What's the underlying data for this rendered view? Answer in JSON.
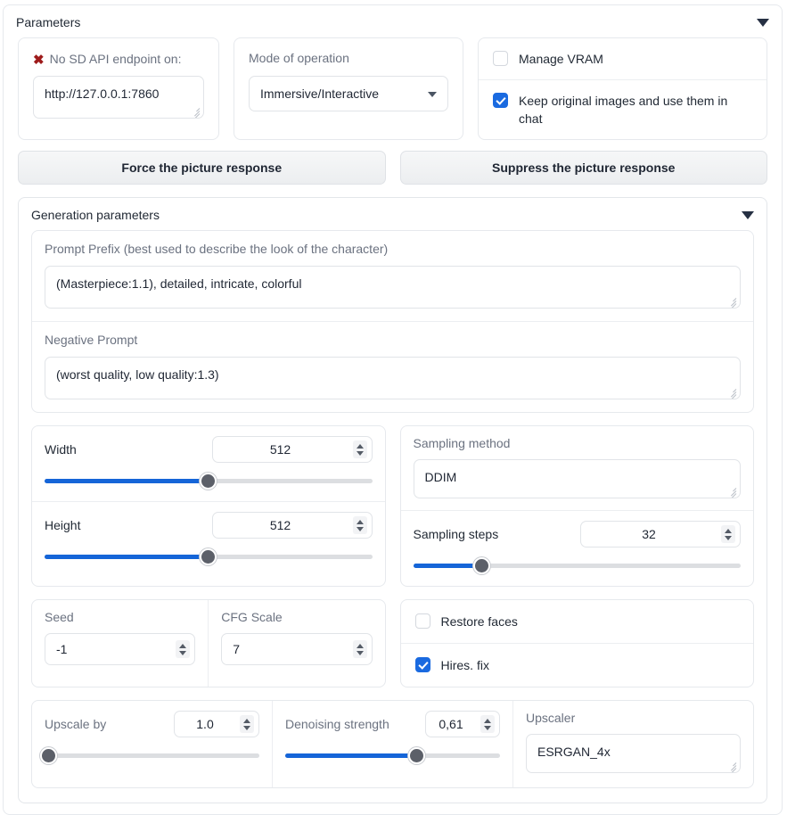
{
  "root": {
    "title": "Parameters",
    "collapse_icon": "caret-down-icon"
  },
  "api": {
    "status_icon": "red-x-icon",
    "status_label": "No SD API endpoint on:",
    "endpoint_value": "http://127.0.0.1:7860"
  },
  "mode": {
    "label": "Mode of operation",
    "selected": "Immersive/Interactive",
    "dropdown_icon": "chevron-down-icon"
  },
  "options": {
    "manage_vram": {
      "label": "Manage VRAM",
      "checked": false
    },
    "keep_original": {
      "label": "Keep original images and use them in chat",
      "checked": true
    }
  },
  "buttons": {
    "force": "Force the picture response",
    "suppress": "Suppress the picture response"
  },
  "generation": {
    "title": "Generation parameters",
    "collapse_icon": "caret-down-icon",
    "prompt_prefix": {
      "label": "Prompt Prefix (best used to describe the look of the character)",
      "value": "(Masterpiece:1.1), detailed, intricate, colorful"
    },
    "negative_prompt": {
      "label": "Negative Prompt",
      "value": "(worst quality, low quality:1.3)"
    },
    "width": {
      "label": "Width",
      "value": "512",
      "percent": 50
    },
    "height": {
      "label": "Height",
      "value": "512",
      "percent": 50
    },
    "sampling_method": {
      "label": "Sampling method",
      "value": "DDIM"
    },
    "sampling_steps": {
      "label": "Sampling steps",
      "value": "32",
      "percent": 21
    },
    "seed": {
      "label": "Seed",
      "value": "-1"
    },
    "cfg_scale": {
      "label": "CFG Scale",
      "value": "7"
    },
    "restore_faces": {
      "label": "Restore faces",
      "checked": false
    },
    "hires_fix": {
      "label": "Hires. fix",
      "checked": true
    },
    "upscale_by": {
      "label": "Upscale by",
      "value": "1.0",
      "percent": 2
    },
    "denoising_strength": {
      "label": "Denoising strength",
      "value": "0,61",
      "percent": 61
    },
    "upscaler": {
      "label": "Upscaler",
      "value": "ESRGAN_4x"
    }
  },
  "colors": {
    "accent_blue": "#1565d8",
    "checkbox_blue": "#1a6ae0",
    "error_red": "#9e1b1b",
    "border": "#e6e9ed",
    "label_grey": "#6b7280"
  }
}
